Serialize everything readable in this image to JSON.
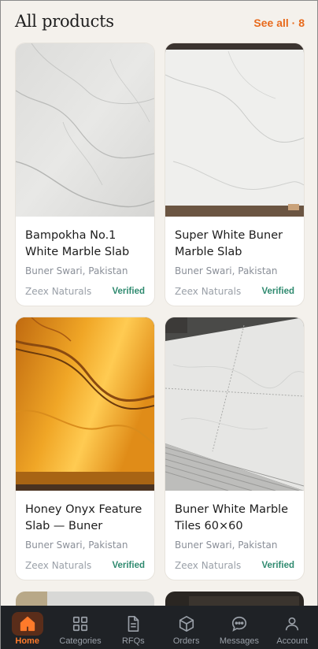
{
  "header": {
    "title": "All products",
    "see_all": "See all · 8"
  },
  "products": [
    {
      "title_line1": "Bampokha No.1",
      "title_line2": "White Marble Slab",
      "location": "Buner Swari, Pakistan",
      "seller": "Zeex Naturals",
      "badge": "Verified",
      "image": "white-marble-veined"
    },
    {
      "title_line1": "Super White Buner",
      "title_line2": "Marble Slab",
      "location": "Buner Swari, Pakistan",
      "seller": "Zeex Naturals",
      "badge": "Verified",
      "image": "super-white-marble-slab"
    },
    {
      "title_line1": "Honey Onyx Feature",
      "title_line2": "Slab — Buner",
      "location": "Buner Swari, Pakistan",
      "seller": "Zeex Naturals",
      "badge": "Verified",
      "image": "honey-onyx-slab"
    },
    {
      "title_line1": "Buner White Marble",
      "title_line2": "Tiles 60×60",
      "location": "Buner Swari, Pakistan",
      "seller": "Zeex Naturals",
      "badge": "Verified",
      "image": "white-marble-tiles-stack"
    }
  ],
  "nav": {
    "items": [
      {
        "label": "Home",
        "icon": "home-icon",
        "active": true
      },
      {
        "label": "Categories",
        "icon": "grid-icon",
        "active": false
      },
      {
        "label": "RFQs",
        "icon": "document-icon",
        "active": false
      },
      {
        "label": "Orders",
        "icon": "box-icon",
        "active": false
      },
      {
        "label": "Messages",
        "icon": "chat-icon",
        "active": false
      },
      {
        "label": "Account",
        "icon": "user-icon",
        "active": false
      }
    ]
  },
  "colors": {
    "accent": "#e86a1c",
    "verified": "#2f8a6f",
    "nav_bg": "#1f2226",
    "page_bg": "#f4f1ec"
  }
}
